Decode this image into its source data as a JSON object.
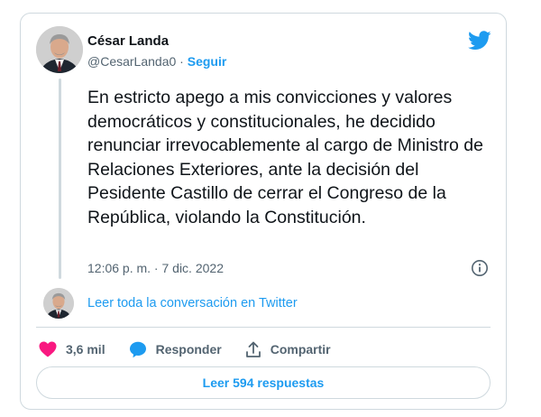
{
  "author": {
    "name": "César Landa",
    "handle": "@CesarLanda0",
    "separator": "·",
    "follow_label": "Seguir"
  },
  "tweet": {
    "text": "En estricto apego a mis convicciones y valores democráticos y constitucionales, he decidido renunciar irrevocablemente al cargo de Ministro de Relaciones Exteriores, ante la decisión del Pesidente Castillo de cerrar el Congreso de la República, violando la Constitución.",
    "timestamp": "12:06 p. m. · 7 dic. 2022"
  },
  "conversation_link": "Leer toda la conversación en Twitter",
  "actions": {
    "likes": "3,6 mil",
    "reply_label": "Responder",
    "share_label": "Compartir"
  },
  "replies_button": "Leer 594 respuestas",
  "colors": {
    "accent": "#1d9bf0",
    "like": "#f91880",
    "muted": "#536471",
    "border": "#cfd9de"
  },
  "icons": [
    "twitter-bird-icon",
    "info-icon",
    "heart-icon",
    "speech-bubble-icon",
    "share-icon"
  ]
}
